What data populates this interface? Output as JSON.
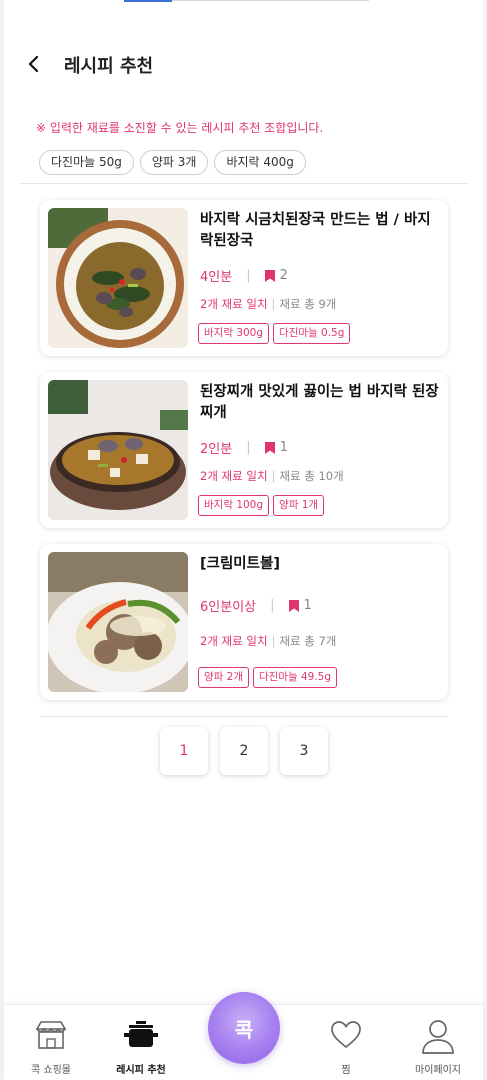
{
  "header": {
    "title": "레시피 추천",
    "back_icon": "chevron-left-icon"
  },
  "notice": "※ 입력한 재료를 소진할 수 있는 레시피 추천 조합입니다.",
  "ingredients": [
    "다진마늘 50g",
    "양파 3개",
    "바지락 400g"
  ],
  "recipes": [
    {
      "title": "바지락 시금치된장국 만드는 법 / 바지락된장국",
      "serving": "4인분",
      "bookmarks": "2",
      "match": "2개 재료 일치",
      "total": "재료 총 9개",
      "tags": [
        "바지락 300g",
        "다진마늘 0.5g"
      ]
    },
    {
      "title": "된장찌개 맛있게 끓이는 법 바지락 된장찌개",
      "serving": "2인분",
      "bookmarks": "1",
      "match": "2개 재료 일치",
      "total": "재료 총 10개",
      "tags": [
        "바지락 100g",
        "양파 1개"
      ]
    },
    {
      "title": "[크림미트볼]",
      "serving": "6인분이상",
      "bookmarks": "1",
      "match": "2개 재료 일치",
      "total": "재료 총 7개",
      "tags": [
        "양파 2개",
        "다진마늘 49.5g"
      ]
    }
  ],
  "pagination": {
    "pages": [
      "1",
      "2",
      "3"
    ],
    "current": "1"
  },
  "bottom_nav": {
    "items": [
      {
        "label": "콕 쇼핑몰",
        "icon": "shop-icon"
      },
      {
        "label": "레시피 추천",
        "icon": "pot-icon",
        "active": true
      },
      {
        "label": "찜",
        "icon": "heart-icon"
      },
      {
        "label": "마이페이지",
        "icon": "user-icon"
      }
    ],
    "fab_label": "콕"
  },
  "colors": {
    "accent": "#e0366b",
    "fab": "#a57ff0",
    "progress": "#3b6fd8"
  }
}
